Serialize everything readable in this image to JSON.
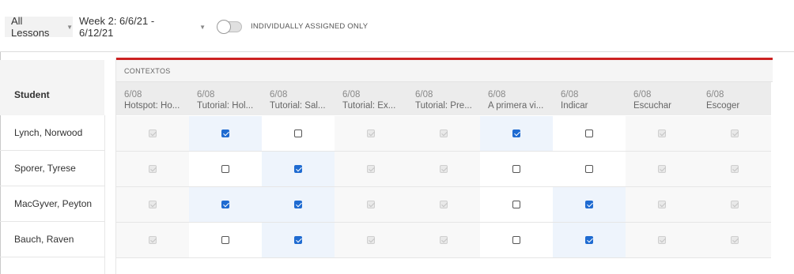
{
  "toolbar": {
    "lessons_dropdown": "All Lessons",
    "week_dropdown": "Week 2: 6/6/21 - 6/12/21",
    "toggle_label": "INDIVIDUALLY ASSIGNED ONLY",
    "toggle_on": false
  },
  "table": {
    "student_header": "Student",
    "group_label": "CONTEXTOS",
    "accent_color": "#cc2222",
    "checkbox_color": "#1f6bd1",
    "columns": [
      {
        "date": "6/08",
        "name": "Hotspot: Ho..."
      },
      {
        "date": "6/08",
        "name": "Tutorial: Hol..."
      },
      {
        "date": "6/08",
        "name": "Tutorial: Sal..."
      },
      {
        "date": "6/08",
        "name": "Tutorial: Ex..."
      },
      {
        "date": "6/08",
        "name": "Tutorial: Pre..."
      },
      {
        "date": "6/08",
        "name": "A primera vi..."
      },
      {
        "date": "6/08",
        "name": "Indicar"
      },
      {
        "date": "6/08",
        "name": "Escuchar"
      },
      {
        "date": "6/08",
        "name": "Escoger"
      }
    ],
    "rows": [
      {
        "student": "Lynch, Norwood",
        "cells": [
          "disabled",
          "checked",
          "unchecked",
          "disabled",
          "disabled",
          "checked",
          "unchecked",
          "disabled",
          "disabled"
        ]
      },
      {
        "student": "Sporer, Tyrese",
        "cells": [
          "disabled",
          "unchecked",
          "checked",
          "disabled",
          "disabled",
          "unchecked",
          "unchecked",
          "disabled",
          "disabled"
        ]
      },
      {
        "student": "MacGyver, Peyton",
        "cells": [
          "disabled",
          "checked",
          "checked",
          "disabled",
          "disabled",
          "unchecked",
          "checked",
          "disabled",
          "disabled"
        ]
      },
      {
        "student": "Bauch, Raven",
        "cells": [
          "disabled",
          "unchecked",
          "checked",
          "disabled",
          "disabled",
          "unchecked",
          "checked",
          "disabled",
          "disabled"
        ]
      }
    ]
  }
}
